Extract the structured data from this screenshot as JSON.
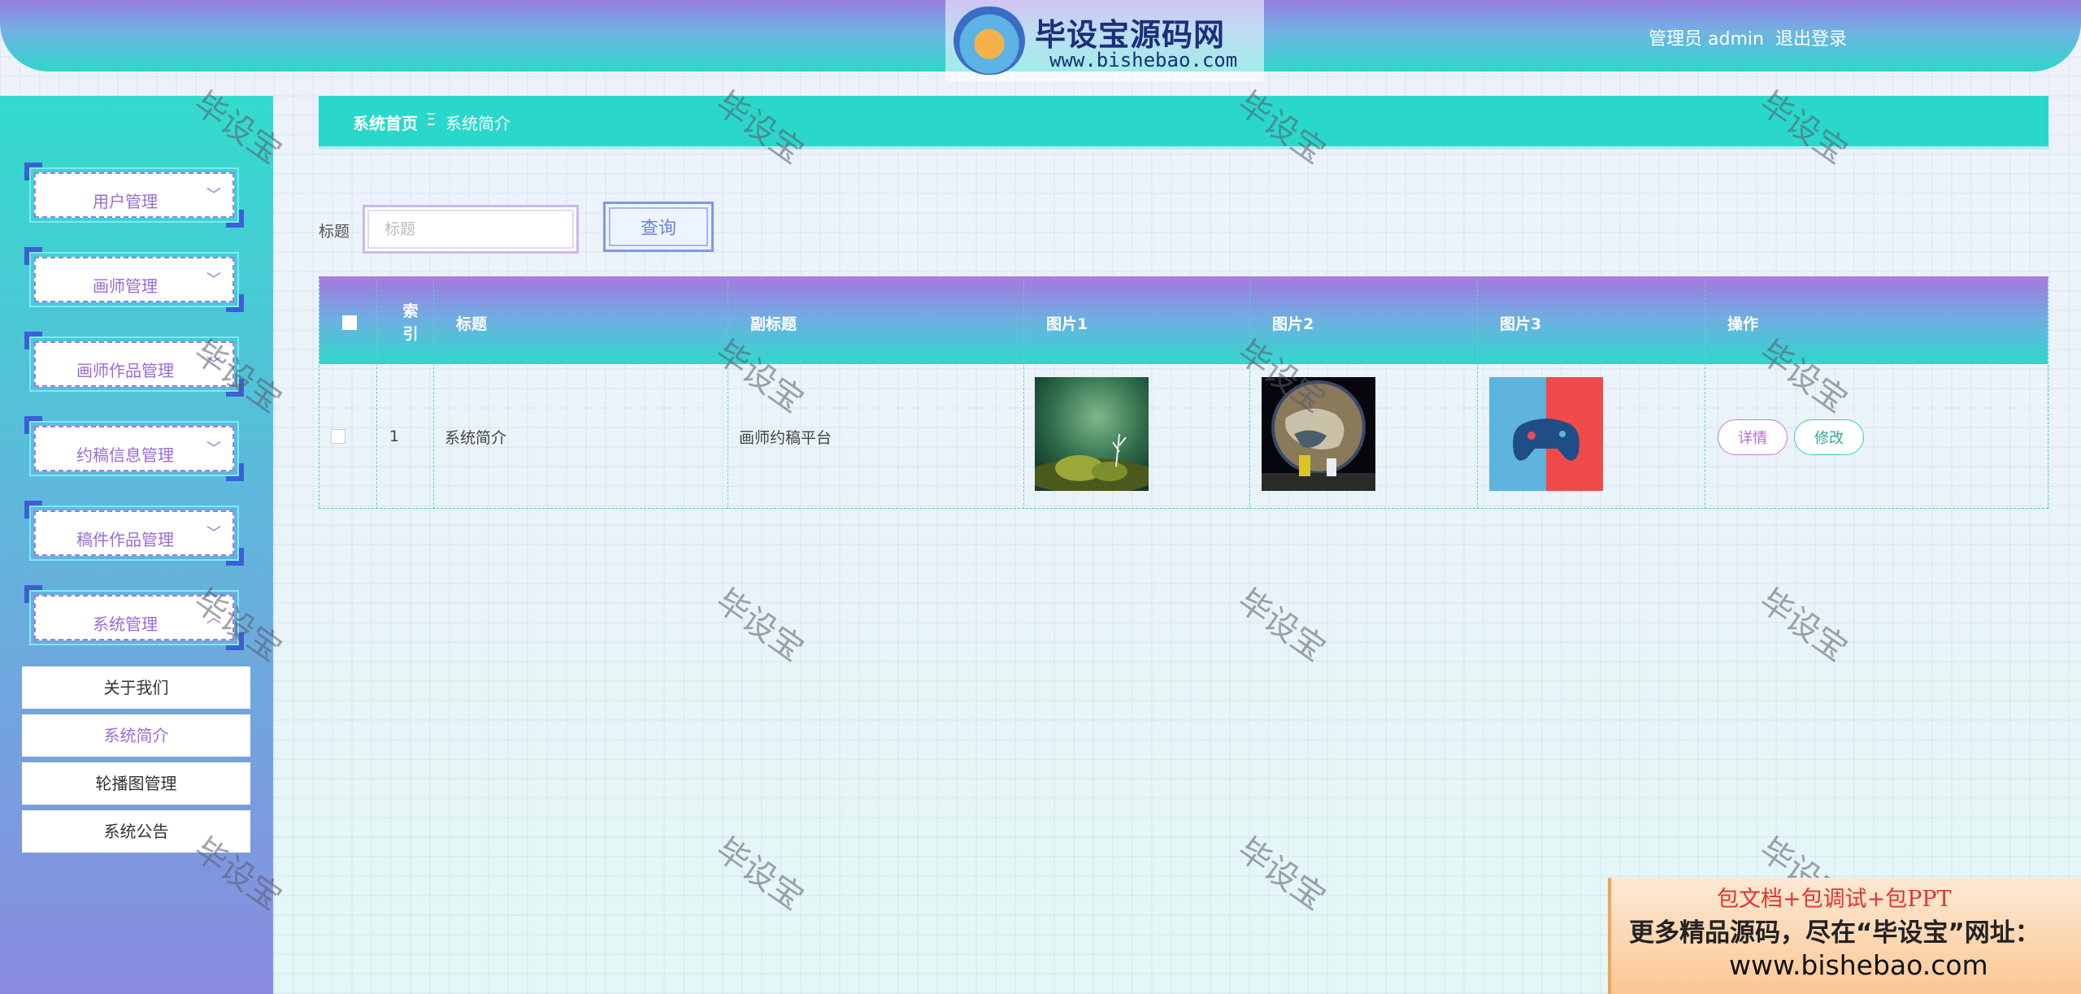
{
  "header": {
    "brand_badge": "毕设宝",
    "brand_title": "毕设宝源码网",
    "brand_url": "www.bishebao.com",
    "user": "管理员 admin",
    "logout": "退出登录"
  },
  "sidebar": {
    "menus": [
      {
        "label": "用户管理"
      },
      {
        "label": "画师管理"
      },
      {
        "label": "画师作品管理"
      },
      {
        "label": "约稿信息管理"
      },
      {
        "label": "稿件作品管理"
      },
      {
        "label": "系统管理"
      }
    ],
    "submenus": [
      {
        "label": "关于我们"
      },
      {
        "label": "系统简介"
      },
      {
        "label": "轮播图管理"
      },
      {
        "label": "系统公告"
      }
    ]
  },
  "breadcrumb": {
    "home": "系统首页",
    "separator": "Ξ",
    "current": "系统简介"
  },
  "search": {
    "label": "标题",
    "placeholder": "标题",
    "button": "查询"
  },
  "table": {
    "columns": [
      "索引",
      "标题",
      "副标题",
      "图片1",
      "图片2",
      "图片3",
      "操作"
    ],
    "rows": [
      {
        "index": "1",
        "title": "系统简介",
        "subtitle": "画师约稿平台"
      }
    ],
    "actions": {
      "detail": "详情",
      "edit": "修改"
    }
  },
  "watermark": "毕设宝",
  "promo": {
    "line1": "包文档+包调试+包PPT",
    "line2": "更多精品源码，尽在“毕设宝”网址：",
    "line3": "www.bishebao.com"
  },
  "colors": {
    "accent_teal": "#2ad8cb",
    "accent_purple": "#a07ce0",
    "menu_text": "#9a6bd6"
  }
}
